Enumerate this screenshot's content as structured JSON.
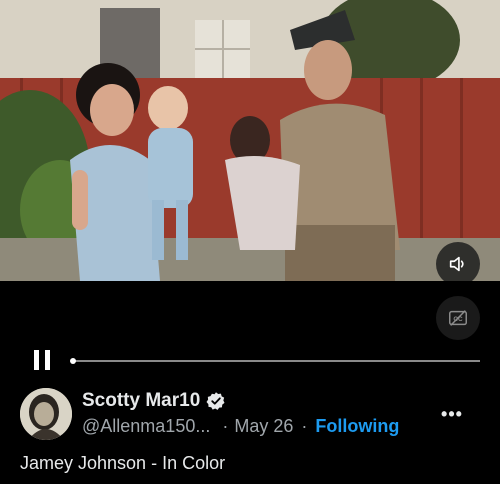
{
  "video": {
    "scene_alt": "Vintage family photo video frame"
  },
  "controls": {
    "volume_icon": "speaker-icon",
    "captions_icon": "closed-captions-icon",
    "captions_text": "CC",
    "pause_icon": "pause-icon",
    "progress": 0.0
  },
  "post": {
    "author_name": "Scotty Mar10",
    "handle": "@Allenma150...",
    "separator": "·",
    "date": "May 26",
    "follow_label": "Following",
    "more_icon": "more-options-icon",
    "more_text": "•••",
    "caption": "Jamey Johnson - In Color"
  },
  "colors": {
    "accent": "#1d9bf0",
    "background": "#000000",
    "text_primary": "#e7e9ea",
    "text_secondary": "#a0a6ab"
  }
}
